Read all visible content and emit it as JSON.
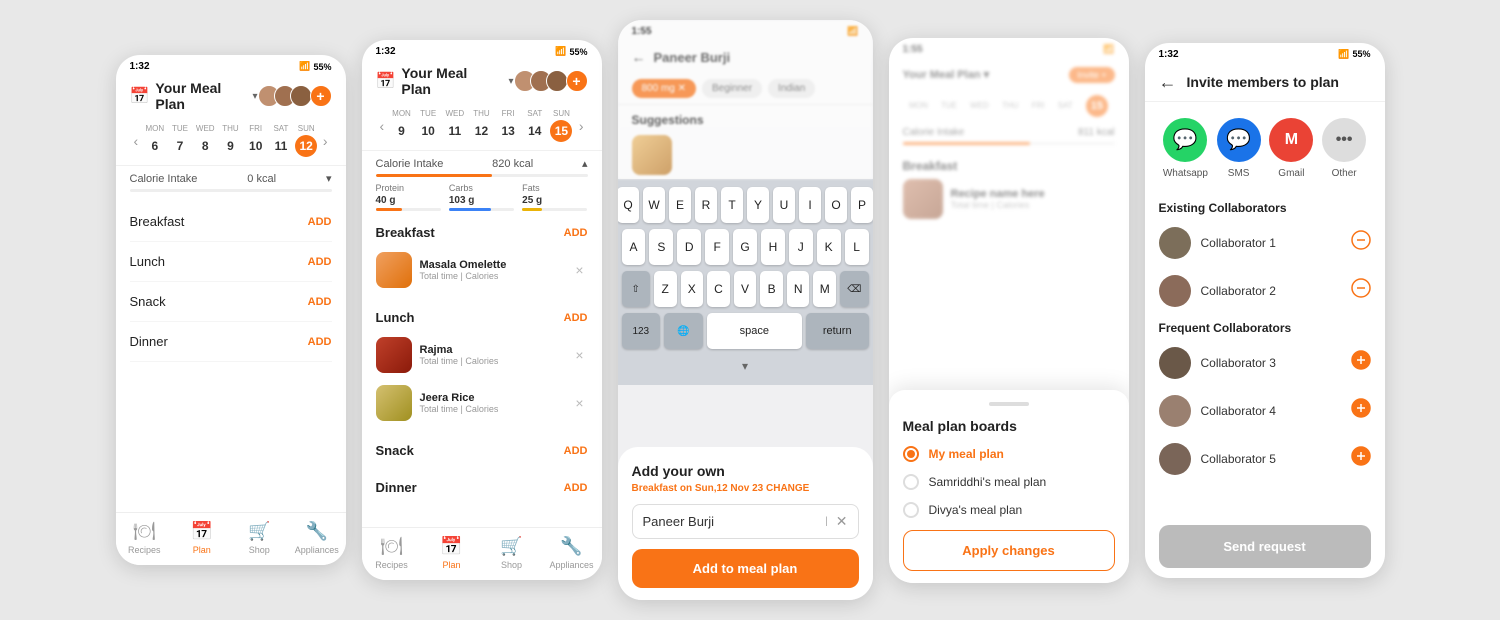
{
  "screens": {
    "screen1": {
      "statusBar": {
        "time": "1:32",
        "battery": "55%"
      },
      "header": {
        "title": "Your Meal Plan",
        "chevron": "▾"
      },
      "calendar": {
        "days": [
          "MON",
          "TUE",
          "WED",
          "THU",
          "FRI",
          "SAT",
          "SUN"
        ],
        "dates": [
          "6",
          "7",
          "8",
          "9",
          "10",
          "11",
          "12"
        ],
        "activeIndex": 6
      },
      "calorie": {
        "label": "Calorie Intake",
        "value": "0 kcal"
      },
      "meals": [
        {
          "name": "Breakfast",
          "action": "ADD"
        },
        {
          "name": "Lunch",
          "action": "ADD"
        },
        {
          "name": "Snack",
          "action": "ADD"
        },
        {
          "name": "Dinner",
          "action": "ADD"
        }
      ],
      "nav": [
        {
          "icon": "🍽",
          "label": "Recipes",
          "active": false
        },
        {
          "icon": "📅",
          "label": "Plan",
          "active": true
        },
        {
          "icon": "🛒",
          "label": "Shop",
          "active": false
        },
        {
          "icon": "🔧",
          "label": "Appliances",
          "active": false
        }
      ]
    },
    "screen2": {
      "statusBar": {
        "time": "1:32",
        "battery": "55%"
      },
      "header": {
        "title": "Your Meal Plan",
        "chevron": "▾"
      },
      "calendar": {
        "days": [
          "MON",
          "TUE",
          "WED",
          "THU",
          "FRI",
          "SAT",
          "SUN"
        ],
        "dates": [
          "9",
          "10",
          "11",
          "12",
          "13",
          "14",
          "15"
        ],
        "activeIndex": 6
      },
      "calorie": {
        "label": "Calorie Intake",
        "value": "820 kcal"
      },
      "macros": [
        {
          "label": "Protein",
          "value": "40 g",
          "type": "protein",
          "pct": 40
        },
        {
          "label": "Carbs",
          "value": "103 g",
          "type": "carbs",
          "pct": 65
        },
        {
          "label": "Fats",
          "value": "25 g",
          "type": "fats",
          "pct": 30
        }
      ],
      "meals": [
        {
          "name": "Breakfast",
          "action": "ADD",
          "items": [
            {
              "name": "Masala Omelette",
              "meta": "Total time | Calories",
              "imgClass": "food-img-masala"
            }
          ]
        },
        {
          "name": "Lunch",
          "action": "ADD",
          "items": [
            {
              "name": "Rajma",
              "meta": "Total time | Calories",
              "imgClass": "food-img-rajma"
            },
            {
              "name": "Jeera Rice",
              "meta": "Total time | Calories",
              "imgClass": "food-img-jeera"
            }
          ]
        },
        {
          "name": "Snack",
          "action": "ADD",
          "items": []
        },
        {
          "name": "Dinner",
          "action": "ADD",
          "items": []
        }
      ],
      "nav": [
        {
          "icon": "🍽",
          "label": "Recipes",
          "active": false
        },
        {
          "icon": "📅",
          "label": "Plan",
          "active": true
        },
        {
          "icon": "🛒",
          "label": "Shop",
          "active": false
        },
        {
          "icon": "🔧",
          "label": "Appliances",
          "active": false
        }
      ]
    },
    "screen3": {
      "statusBar": {
        "time": "1:55",
        "battery": ""
      },
      "searchTitle": "Paneer Burji",
      "tags": [
        {
          "label": "800 mg ✕",
          "active": true
        },
        {
          "label": "Beginner",
          "active": false
        },
        {
          "label": "Indian",
          "active": false
        }
      ],
      "suggestionsTitle": "Suggestions",
      "dialog": {
        "title": "Add your own",
        "subtitle": "Breakfast",
        "subtitleDate": "on Sun,12 Nov 23",
        "changeLabel": "CHANGE",
        "inputValue": "Paneer Burji",
        "inputCursor": true,
        "addButtonLabel": "Add to meal plan"
      },
      "keyboard": {
        "rows": [
          [
            "Q",
            "W",
            "E",
            "R",
            "T",
            "Y",
            "U",
            "I",
            "O",
            "P"
          ],
          [
            "A",
            "S",
            "D",
            "F",
            "G",
            "H",
            "J",
            "K",
            "L"
          ],
          [
            "⇧",
            "Z",
            "X",
            "C",
            "V",
            "B",
            "N",
            "M",
            "⌫"
          ],
          [
            "123",
            "🌐",
            "space",
            "return"
          ]
        ]
      }
    },
    "screen4": {
      "statusBar": {
        "time": "1:55",
        "battery": ""
      },
      "boards": {
        "title": "Meal plan boards",
        "options": [
          {
            "name": "My meal plan",
            "selected": true
          },
          {
            "name": "Samriddhi's meal plan",
            "selected": false
          },
          {
            "name": "Divya's meal plan",
            "selected": false
          }
        ],
        "applyLabel": "Apply changes"
      },
      "blurredContent": {
        "calorie": "Calorie Intake • 811 kcal",
        "mealName": "Breakfast",
        "recipeName": "Recipe name here",
        "recipeMeta": "Total time | Calories"
      }
    },
    "screen5": {
      "statusBar": {
        "time": "1:32",
        "battery": "55%"
      },
      "header": {
        "backLabel": "←",
        "title": "Invite members to plan"
      },
      "shareIcons": [
        {
          "icon": "💬",
          "label": "Whatsapp",
          "color": "#25D366"
        },
        {
          "icon": "💬",
          "label": "SMS",
          "color": "#1a73e8"
        },
        {
          "icon": "M",
          "label": "Gmail",
          "color": "#EA4335"
        },
        {
          "icon": "•••",
          "label": "Other",
          "color": "#999"
        }
      ],
      "existingCollaboratorsTitle": "Existing Collaborators",
      "existingCollaborators": [
        {
          "name": "Collaborator 1",
          "action": "remove",
          "avatarClass": "ca1"
        },
        {
          "name": "Collaborator 2",
          "action": "remove",
          "avatarClass": "ca2"
        }
      ],
      "frequentCollaboratorsTitle": "Frequent Collaborators",
      "frequentCollaborators": [
        {
          "name": "Collaborator 3",
          "action": "add",
          "avatarClass": "ca3"
        },
        {
          "name": "Collaborator 4",
          "action": "add",
          "avatarClass": "ca4"
        },
        {
          "name": "Collaborator 5",
          "action": "add",
          "avatarClass": "ca5"
        }
      ],
      "sendRequestLabel": "Send request"
    }
  }
}
